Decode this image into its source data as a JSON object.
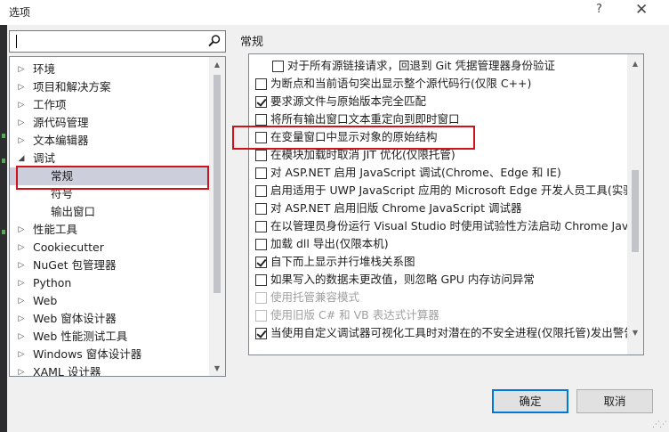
{
  "window": {
    "title": "选项",
    "help_glyph": "?",
    "close_glyph": "✕"
  },
  "search": {
    "value": "",
    "placeholder": ""
  },
  "tree": {
    "items": [
      {
        "label": "环境",
        "arrow": "▷",
        "level": 0
      },
      {
        "label": "项目和解决方案",
        "arrow": "▷",
        "level": 0
      },
      {
        "label": "工作项",
        "arrow": "▷",
        "level": 0
      },
      {
        "label": "源代码管理",
        "arrow": "▷",
        "level": 0
      },
      {
        "label": "文本编辑器",
        "arrow": "▷",
        "level": 0
      },
      {
        "label": "调试",
        "arrow": "◢",
        "level": 0
      },
      {
        "label": "常规",
        "arrow": "",
        "level": 1,
        "selected": true
      },
      {
        "label": "符号",
        "arrow": "",
        "level": 1
      },
      {
        "label": "输出窗口",
        "arrow": "",
        "level": 1
      },
      {
        "label": "性能工具",
        "arrow": "▷",
        "level": 0
      },
      {
        "label": "Cookiecutter",
        "arrow": "▷",
        "level": 0
      },
      {
        "label": "NuGet 包管理器",
        "arrow": "▷",
        "level": 0
      },
      {
        "label": "Python",
        "arrow": "▷",
        "level": 0
      },
      {
        "label": "Web",
        "arrow": "▷",
        "level": 0
      },
      {
        "label": "Web 窗体设计器",
        "arrow": "▷",
        "level": 0
      },
      {
        "label": "Web 性能测试工具",
        "arrow": "▷",
        "level": 0
      },
      {
        "label": "Windows 窗体设计器",
        "arrow": "▷",
        "level": 0
      },
      {
        "label": "XAML 设计器",
        "arrow": "▷",
        "level": 0
      }
    ]
  },
  "section": {
    "title": "常规"
  },
  "options": [
    {
      "label": "对于所有源链接请求，回退到 Git 凭据管理器身份验证",
      "checked": false,
      "indent": 1,
      "disabled": false
    },
    {
      "label": "为断点和当前语句突出显示整个源代码行(仅限 C++)",
      "checked": false,
      "indent": 0,
      "disabled": false
    },
    {
      "label": "要求源文件与原始版本完全匹配",
      "checked": true,
      "indent": 0,
      "disabled": false
    },
    {
      "label": "将所有输出窗口文本重定向到即时窗口",
      "checked": false,
      "indent": 0,
      "disabled": false
    },
    {
      "label": "在变量窗口中显示对象的原始结构",
      "checked": false,
      "indent": 0,
      "disabled": false
    },
    {
      "label": "在模块加载时取消 JIT 优化(仅限托管)",
      "checked": false,
      "indent": 0,
      "disabled": false
    },
    {
      "label": "对 ASP.NET 启用 JavaScript 调试(Chrome、Edge 和 IE)",
      "checked": false,
      "indent": 0,
      "disabled": false
    },
    {
      "label": "启用适用于 UWP JavaScript 应用的 Microsoft Edge 开发人员工具(实验版",
      "checked": false,
      "indent": 0,
      "disabled": false
    },
    {
      "label": "对 ASP.NET 启用旧版 Chrome JavaScript 调试器",
      "checked": false,
      "indent": 0,
      "disabled": false
    },
    {
      "label": "在以管理员身份运行 Visual Studio 时使用试验性方法启动 Chrome JavaSc",
      "checked": false,
      "indent": 0,
      "disabled": false
    },
    {
      "label": "加载 dll 导出(仅限本机)",
      "checked": false,
      "indent": 0,
      "disabled": false
    },
    {
      "label": "自下而上显示并行堆栈关系图",
      "checked": true,
      "indent": 0,
      "disabled": false
    },
    {
      "label": "如果写入的数据未更改值，则忽略 GPU 内存访问异常",
      "checked": false,
      "indent": 0,
      "disabled": false
    },
    {
      "label": "使用托管兼容模式",
      "checked": false,
      "indent": 0,
      "disabled": true
    },
    {
      "label": "使用旧版 C# 和 VB 表达式计算器",
      "checked": false,
      "indent": 0,
      "disabled": true
    },
    {
      "label": "当使用自定义调试器可视化工具时对潜在的不安全进程(仅限托管)发出警告",
      "checked": true,
      "indent": 0,
      "disabled": false
    }
  ],
  "buttons": {
    "ok": "确定",
    "cancel": "取消"
  },
  "colors": {
    "highlight_box": "#d0121b",
    "selection": "#cccedb",
    "primary_border": "#0078d7"
  }
}
